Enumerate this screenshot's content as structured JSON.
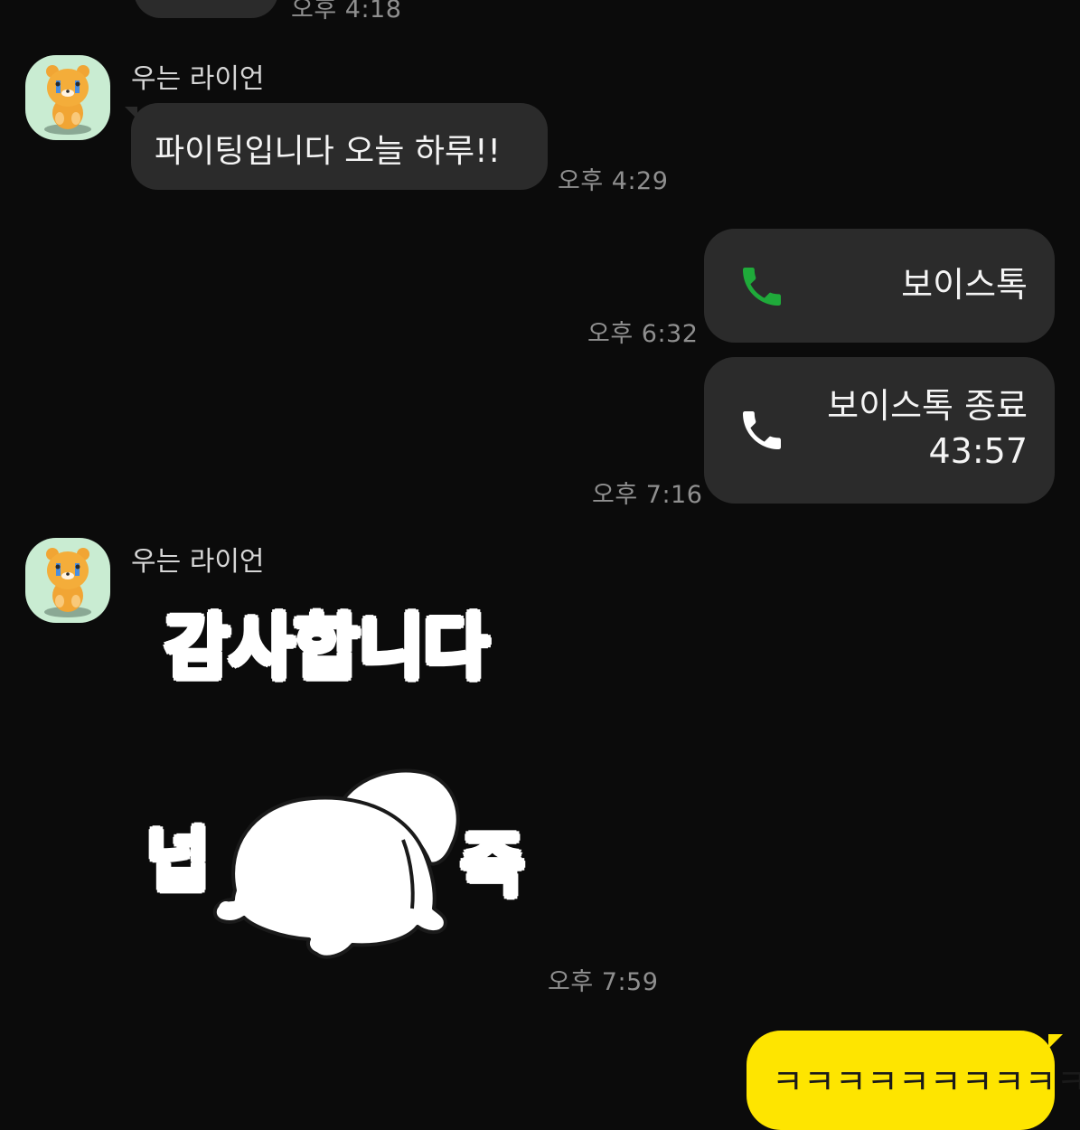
{
  "colors": {
    "background": "#0b0b0b",
    "bubble": "#2b2b2b",
    "my_bubble": "#fee500",
    "avatar_bg": "#c9ecd2",
    "call_green": "#1faa3a",
    "time_text": "#8f8f8f"
  },
  "messages": {
    "top_cut": {
      "time": "오후 4:18"
    },
    "msg1": {
      "sender": "우는 라이언",
      "avatar_icon": "crying-ryan-avatar-icon",
      "text": "파이팅입니다 오늘 하루!!",
      "time": "오후 4:29"
    },
    "call1": {
      "icon": "phone-icon-green",
      "text": "보이스톡",
      "time": "오후 6:32"
    },
    "call2": {
      "icon": "phone-icon-white",
      "text_line1": "보이스톡 종료",
      "text_line2": "43:57",
      "time": "오후 7:16"
    },
    "msg2": {
      "sender": "우는 라이언",
      "avatar_icon": "crying-ryan-avatar-icon",
      "sticker_text_top": "감사합니다",
      "sticker_text_left": "넙",
      "sticker_text_right": "죽",
      "time": "오후 7:59"
    },
    "my_msg": {
      "text": "ㅋㅋㅋㅋㅋㅋㅋㅋㅋㅋ"
    }
  }
}
